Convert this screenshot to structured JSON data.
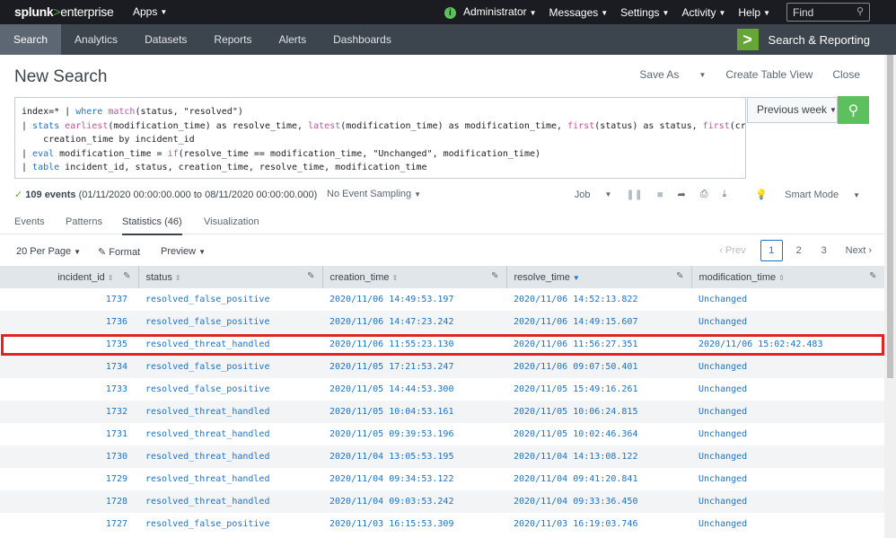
{
  "topbar": {
    "logo_main": "splunk",
    "logo_sep": ">",
    "logo_sub": "enterprise",
    "apps": "Apps",
    "admin_initial": "i",
    "admin": "Administrator",
    "messages": "Messages",
    "settings": "Settings",
    "activity": "Activity",
    "help": "Help",
    "find_placeholder": "Find"
  },
  "appbar": {
    "tabs": [
      "Search",
      "Analytics",
      "Datasets",
      "Reports",
      "Alerts",
      "Dashboards"
    ],
    "app_title": "Search & Reporting"
  },
  "page": {
    "title": "New Search",
    "save_as": "Save As",
    "create_table_view": "Create Table View",
    "close": "Close"
  },
  "search": {
    "line1_a": "index=* | ",
    "line1_kw": "where",
    "line1_fn": " match",
    "line1_b": "(status, \"resolved\")",
    "line2_pipe": "| ",
    "line2_kw": "stats",
    "line2_fn1": " earliest",
    "line2_b": "(modification_time) as resolve_time, ",
    "line2_fn2": "latest",
    "line2_c": "(modification_time) as modification_time, ",
    "line2_fn3": "first",
    "line2_d": "(status) as status, ",
    "line2_fn4": "first",
    "line2_e": "(creation_time) a",
    "line3": "    creation_time by incident_id",
    "line4_pipe": "| ",
    "line4_kw": "eval",
    "line4_b": " modification_time = ",
    "line4_fn": "if",
    "line4_c": "(resolve_time == modification_time, \"Unchanged\", modification_time)",
    "line5_pipe": "| ",
    "line5_kw": "table",
    "line5_b": " incident_id, status, creation_time, resolve_time, modification_time",
    "time_range": "Previous week"
  },
  "status": {
    "events": "109 events",
    "range": " (01/11/2020 00:00:00.000 to 08/11/2020 00:00:00.000)",
    "sampling": "No Event Sampling",
    "job": "Job",
    "mode": "Smart Mode"
  },
  "subtabs": [
    "Events",
    "Patterns",
    "Statistics (46)",
    "Visualization"
  ],
  "toolbar": {
    "per_page": "20 Per Page",
    "format": "Format",
    "preview": "Preview",
    "prev": "‹ Prev",
    "pages": [
      "1",
      "2",
      "3"
    ],
    "next": "Next ›"
  },
  "table": {
    "columns": [
      "incident_id",
      "status",
      "creation_time",
      "resolve_time",
      "modification_time"
    ],
    "rows": [
      [
        "1737",
        "resolved_false_positive",
        "2020/11/06 14:49:53.197",
        "2020/11/06 14:52:13.822",
        "Unchanged"
      ],
      [
        "1736",
        "resolved_false_positive",
        "2020/11/06 14:47:23.242",
        "2020/11/06 14:49:15.607",
        "Unchanged"
      ],
      [
        "1735",
        "resolved_threat_handled",
        "2020/11/06 11:55:23.130",
        "2020/11/06 11:56:27.351",
        "2020/11/06 15:02:42.483"
      ],
      [
        "1734",
        "resolved_false_positive",
        "2020/11/05 17:21:53.247",
        "2020/11/06 09:07:50.401",
        "Unchanged"
      ],
      [
        "1733",
        "resolved_false_positive",
        "2020/11/05 14:44:53.300",
        "2020/11/05 15:49:16.261",
        "Unchanged"
      ],
      [
        "1732",
        "resolved_threat_handled",
        "2020/11/05 10:04:53.161",
        "2020/11/05 10:06:24.815",
        "Unchanged"
      ],
      [
        "1731",
        "resolved_threat_handled",
        "2020/11/05 09:39:53.196",
        "2020/11/05 10:02:46.364",
        "Unchanged"
      ],
      [
        "1730",
        "resolved_threat_handled",
        "2020/11/04 13:05:53.195",
        "2020/11/04 14:13:08.122",
        "Unchanged"
      ],
      [
        "1729",
        "resolved_threat_handled",
        "2020/11/04 09:34:53.122",
        "2020/11/04 09:41:20.841",
        "Unchanged"
      ],
      [
        "1728",
        "resolved_threat_handled",
        "2020/11/04 09:03:53.242",
        "2020/11/04 09:33:36.450",
        "Unchanged"
      ],
      [
        "1727",
        "resolved_false_positive",
        "2020/11/03 16:15:53.309",
        "2020/11/03 16:19:03.746",
        "Unchanged"
      ]
    ]
  },
  "colors": {
    "accent_green": "#5cc05c",
    "link_blue": "#1a73c7",
    "highlight_red": "#e02424"
  }
}
